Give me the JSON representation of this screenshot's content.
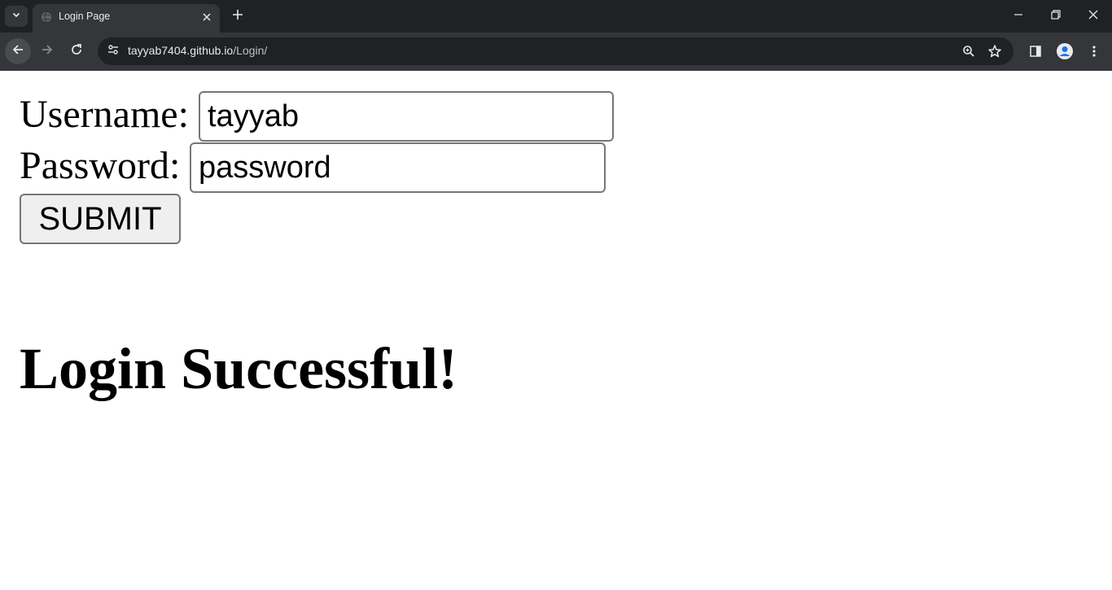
{
  "browser": {
    "tab": {
      "title": "Login Page"
    },
    "address_bar": {
      "host": "tayyab7404.github.io",
      "path": "/Login/"
    }
  },
  "page": {
    "username": {
      "label": "Username:",
      "value": "tayyab"
    },
    "password": {
      "label": "Password:",
      "value": "password"
    },
    "submit_label": "SUBMIT",
    "result_message": "Login Successful!"
  }
}
